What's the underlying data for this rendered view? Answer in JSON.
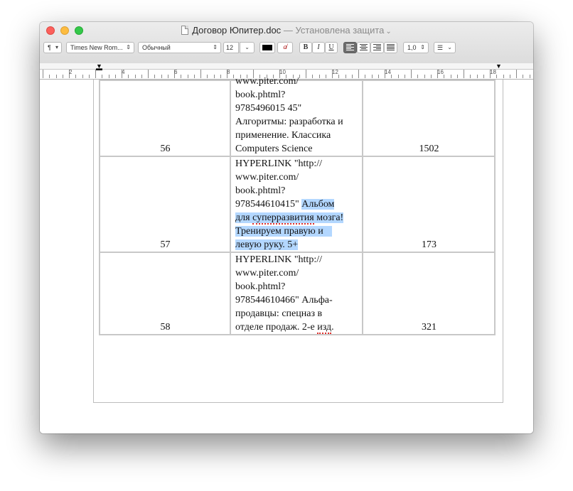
{
  "window": {
    "doc_name": "Договор Юпитер.doc",
    "separator": "—",
    "status": "Установлена защита"
  },
  "toolbar": {
    "paragraph_style": "¶",
    "font_name": "Times New Rom...",
    "font_style": "Обычный",
    "font_size": "12",
    "text_color": "#000000",
    "bold_label": "B",
    "italic_label": "I",
    "underline_label": "U",
    "line_spacing": "1,0",
    "alignment": "left"
  },
  "ruler": {
    "numbers": [
      "2",
      "4",
      "6",
      "8",
      "10",
      "12",
      "14",
      "16",
      "18"
    ]
  },
  "table": {
    "rows": [
      {
        "number": "56",
        "title_lines": [
          "www.piter.com/",
          "book.phtml?",
          "9785496015 45\"",
          "Алгоритмы: разработка и",
          "применение. Классика",
          "Computers Science"
        ],
        "value": "1502"
      },
      {
        "number": "57",
        "title_lines": [
          " HYPERLINK \"http://",
          "www.piter.com/",
          "book.phtml?",
          "978544610415\"",
          "Альбом",
          "для",
          "суперразвития",
          "мозга!",
          "Тренируем правую и",
          "левую руку. 5+"
        ],
        "value": "173"
      },
      {
        "number": "58",
        "title_lines": [
          " HYPERLINK \"http://",
          "www.piter.com/",
          "book.phtml?",
          "978544610466\" Альфа-",
          "продавцы: спецназ в",
          "отделе продаж. 2-е",
          "изд",
          "."
        ],
        "value": "321"
      }
    ]
  },
  "colors": {
    "selection": "#b3d7ff",
    "spellcheck": "#e0302c",
    "close": "#fc605c",
    "minimize": "#fdbc40",
    "zoom": "#34c84a"
  }
}
